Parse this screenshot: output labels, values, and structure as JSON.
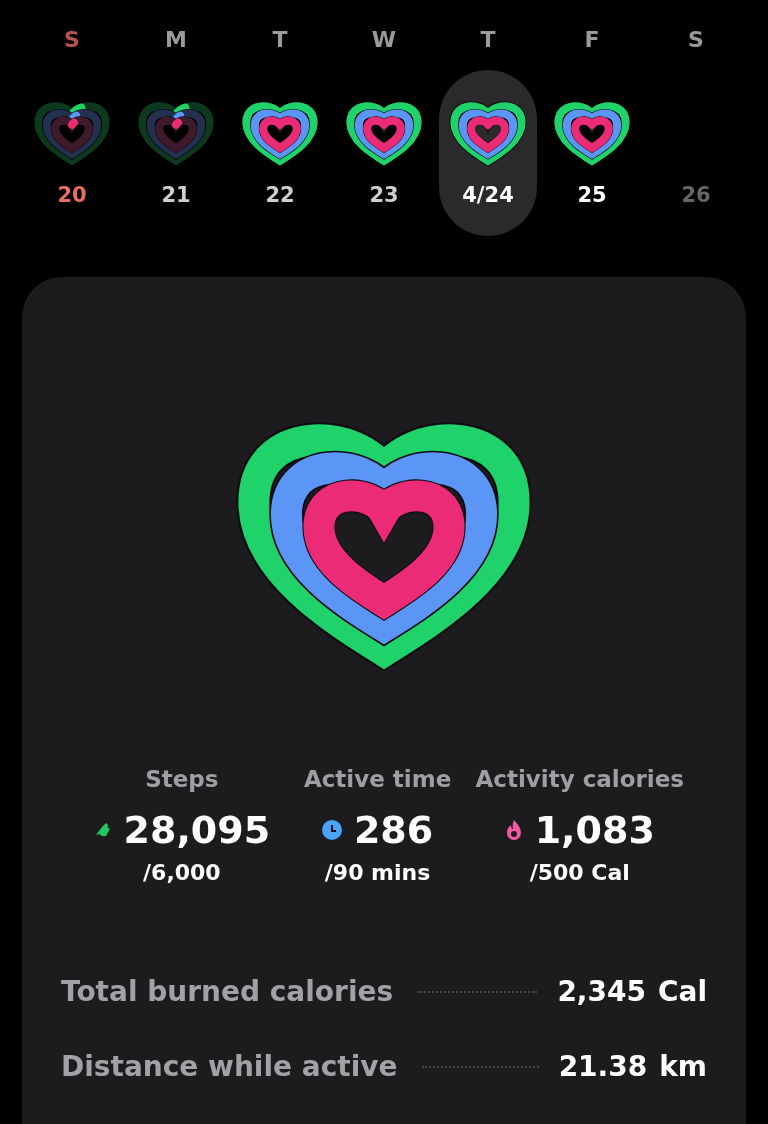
{
  "week": [
    {
      "letter": "S",
      "date": "20",
      "kind": "sunday",
      "selected": false,
      "goals_met": false
    },
    {
      "letter": "M",
      "date": "21",
      "kind": "past",
      "selected": false,
      "goals_met": false
    },
    {
      "letter": "T",
      "date": "22",
      "kind": "past",
      "selected": false,
      "goals_met": true
    },
    {
      "letter": "W",
      "date": "23",
      "kind": "past",
      "selected": false,
      "goals_met": true
    },
    {
      "letter": "T",
      "date": "4/24",
      "kind": "past",
      "selected": true,
      "goals_met": true
    },
    {
      "letter": "F",
      "date": "25",
      "kind": "today",
      "selected": false,
      "goals_met": true
    },
    {
      "letter": "S",
      "date": "26",
      "kind": "future",
      "selected": false
    }
  ],
  "summary": {
    "stats": [
      {
        "label": "Steps",
        "value": "28,095",
        "goal": "/6,000"
      },
      {
        "label": "Active time",
        "value": "286",
        "goal": "/90 mins"
      },
      {
        "label": "Activity calories",
        "value": "1,083",
        "goal": "/500 Cal"
      }
    ],
    "details": [
      {
        "label": "Total burned calories",
        "value": "2,345",
        "unit": "Cal"
      },
      {
        "label": "Distance while active",
        "value": "21.38",
        "unit": "km"
      }
    ]
  }
}
